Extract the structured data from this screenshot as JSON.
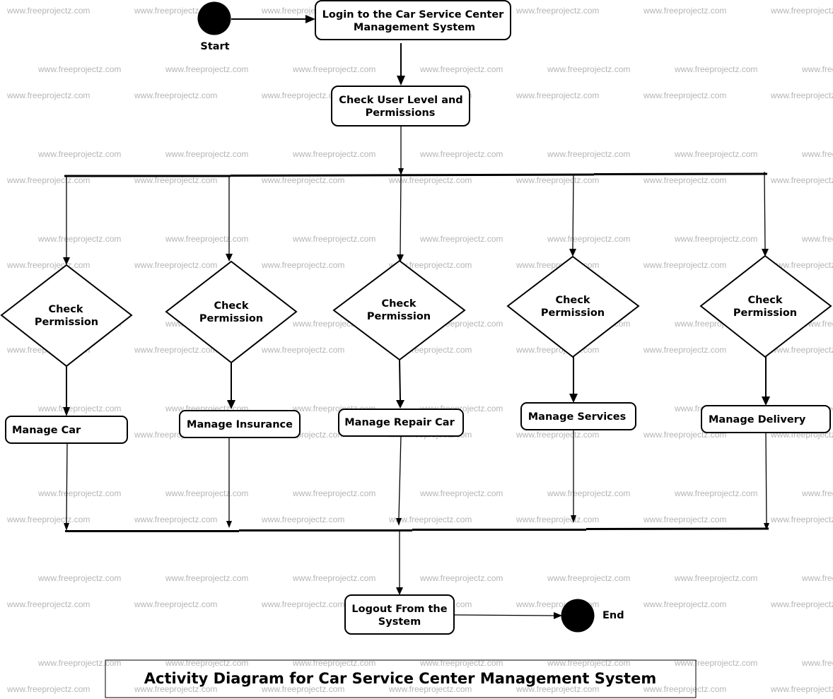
{
  "diagram": {
    "title": "Activity Diagram for Car Service Center Management System",
    "watermark": "www.freeprojectz.com",
    "start": {
      "label": "Start"
    },
    "end": {
      "label": "End"
    },
    "activities": {
      "login": [
        "Login to the Car Service Center",
        "Management System"
      ],
      "check_user": [
        "Check User Level and",
        "Permissions"
      ],
      "logout": [
        "Logout From the",
        "System"
      ]
    },
    "branches": [
      {
        "decision": [
          "Check",
          "Permission"
        ],
        "activity": "Manage Car"
      },
      {
        "decision": [
          "Check",
          "Permission"
        ],
        "activity": "Manage Insurance"
      },
      {
        "decision": [
          "Check",
          "Permission"
        ],
        "activity": "Manage Repair Car"
      },
      {
        "decision": [
          "Check",
          "Permission"
        ],
        "activity": "Manage Services"
      },
      {
        "decision": [
          "Check",
          "Permission"
        ],
        "activity": "Manage Delivery"
      }
    ],
    "flows": [
      {
        "from": "start",
        "to": "login"
      },
      {
        "from": "login",
        "to": "check_user"
      },
      {
        "from": "check_user",
        "to": "fork"
      },
      {
        "from": "fork",
        "to": "branches.*.decision"
      },
      {
        "from": "branches.*.decision",
        "to": "branches.*.activity"
      },
      {
        "from": "branches.*.activity",
        "to": "join"
      },
      {
        "from": "join",
        "to": "logout"
      },
      {
        "from": "logout",
        "to": "end"
      }
    ]
  }
}
